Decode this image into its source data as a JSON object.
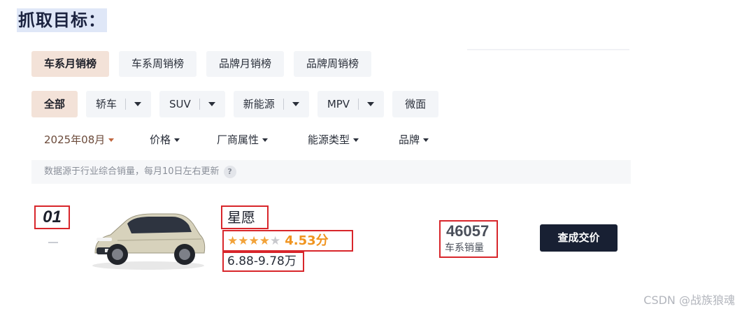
{
  "heading": "抓取目标：",
  "tabs": [
    "车系月销榜",
    "车系周销榜",
    "品牌月销榜",
    "品牌周销榜"
  ],
  "types": {
    "all": "全部",
    "sedan": "轿车",
    "suv": "SUV",
    "nev": "新能源",
    "mpv": "MPV",
    "micro": "微面"
  },
  "filters": {
    "month": "2025年08月",
    "price": "价格",
    "maker": "厂商属性",
    "energy": "能源类型",
    "brand": "品牌"
  },
  "notice": {
    "text": "数据源于行业综合销量，每月10日左右更新",
    "help": "?"
  },
  "entry": {
    "rank": "01",
    "name": "星愿",
    "rating": 4.53,
    "score_text": "4.53分",
    "price": "6.88-9.78万",
    "sales": "46057",
    "sales_label": "车系销量",
    "button": "查成交价"
  },
  "colors": {
    "accent": "#f3e2d8",
    "highlight_box": "#d8262b",
    "star": "#f2a33a",
    "button_bg": "#182033"
  },
  "icons": [
    "chevron-down-icon",
    "star-icon",
    "help-icon",
    "car-image"
  ],
  "watermark": "CSDN @战族狼魂"
}
